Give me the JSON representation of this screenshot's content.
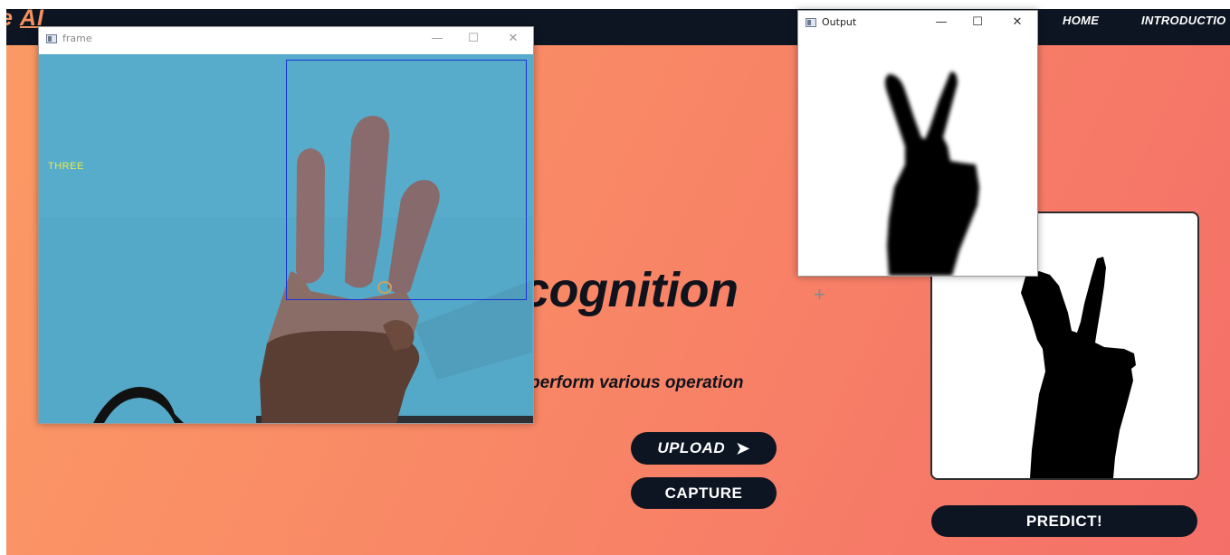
{
  "navbar": {
    "brand_prefix": "e ",
    "brand_suffix": "AI",
    "links": [
      "HOME",
      "INTRODUCTIO"
    ]
  },
  "hero": {
    "title": "cognition",
    "subtitle": "perform various operation"
  },
  "buttons": {
    "upload": "UPLOAD",
    "upload_arrow": "➤",
    "capture": "CAPTURE",
    "predict": "PREDICT!"
  },
  "frame_window": {
    "title": "frame",
    "minimize": "—",
    "maximize": "☐",
    "close": "✕",
    "predicted_label": "THREE"
  },
  "output_window": {
    "title": "Output",
    "minimize": "—",
    "maximize": "☐",
    "close": "✕"
  },
  "colors": {
    "accent": "#f7925f",
    "navbar": "#0d1522",
    "gradient_start": "#fb9a64",
    "gradient_end": "#f46f68",
    "roi_box": "#1d33d6"
  },
  "icons": [
    "upload-arrow-icon",
    "crosshair-icon",
    "window-app-icon"
  ]
}
